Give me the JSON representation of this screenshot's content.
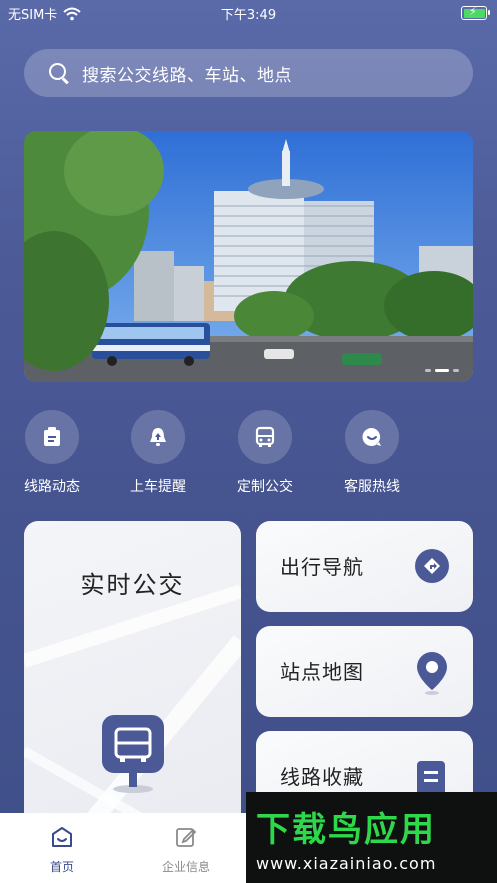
{
  "status_bar": {
    "carrier": "无SIM卡",
    "time": "下午3:49"
  },
  "search": {
    "placeholder": "搜索公交线路、车站、地点"
  },
  "banner": {
    "slide_count": 3,
    "active_slide": 1
  },
  "quick_actions": [
    {
      "label": "线路动态",
      "icon": "route-doc-icon"
    },
    {
      "label": "上车提醒",
      "icon": "bell-icon"
    },
    {
      "label": "定制公交",
      "icon": "bus-icon"
    },
    {
      "label": "客服热线",
      "icon": "chat-icon"
    }
  ],
  "cards": {
    "realtime": {
      "label": "实时公交",
      "icon": "bus-stop-icon"
    },
    "navigation": {
      "label": "出行导航",
      "icon": "navigation-icon"
    },
    "station_map": {
      "label": "站点地图",
      "icon": "map-pin-icon"
    },
    "favorites": {
      "label": "线路收藏",
      "icon": "bookmark-icon"
    }
  },
  "tabbar": [
    {
      "label": "首页",
      "active": true,
      "icon": "home-icon"
    },
    {
      "label": "企业信息",
      "active": false,
      "icon": "edit-icon"
    }
  ],
  "watermark": {
    "brand": "下载鸟应用",
    "url": "www.xiazainiao.com"
  },
  "colors": {
    "accent": "#4b5a97",
    "active_tab": "#3b4a8a",
    "inactive_tab": "#8a8a8a"
  }
}
